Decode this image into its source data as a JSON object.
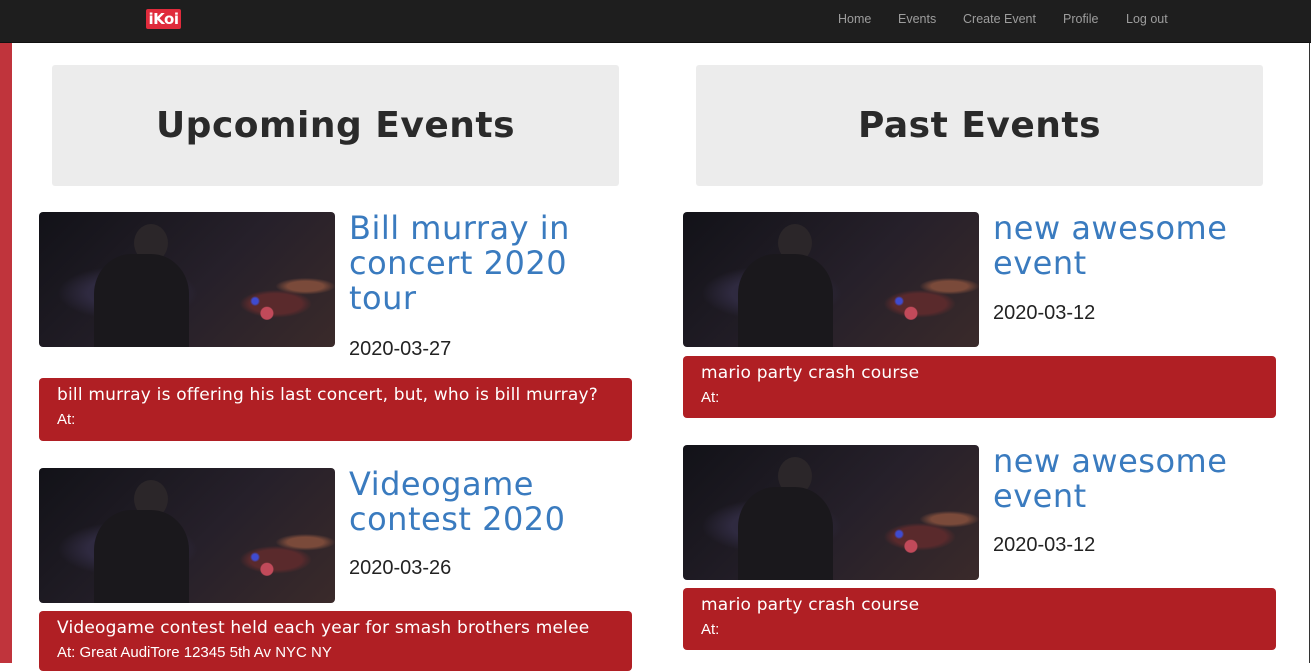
{
  "navbar": {
    "brand": "iKoi",
    "links": [
      "Home",
      "Events",
      "Create Event",
      "Profile",
      "Log out"
    ]
  },
  "upcoming": {
    "heading": "Upcoming Events",
    "events": [
      {
        "title": "Bill murray in concert 2020 tour",
        "date": "2020-03-27",
        "description": "bill murray is offering his last concert, but, who is bill murray?",
        "at": "At:"
      },
      {
        "title": "Videogame contest 2020",
        "date": "2020-03-26",
        "description": "Videogame contest held each year for smash brothers melee",
        "at": "At: Great AudiTore 12345 5th Av NYC NY"
      }
    ]
  },
  "past": {
    "heading": "Past Events",
    "events": [
      {
        "title": "new awesome event",
        "date": "2020-03-12",
        "description": "mario party crash course",
        "at": "At:"
      },
      {
        "title": "new awesome event",
        "date": "2020-03-12",
        "description": "mario party crash course",
        "at": "At:"
      }
    ]
  },
  "colors": {
    "navbar_bg": "#1e1e1e",
    "brand": "#e02b3c",
    "title_link": "#3a7bbf",
    "description_bg": "#b01f24",
    "header_bg": "#ececec"
  }
}
